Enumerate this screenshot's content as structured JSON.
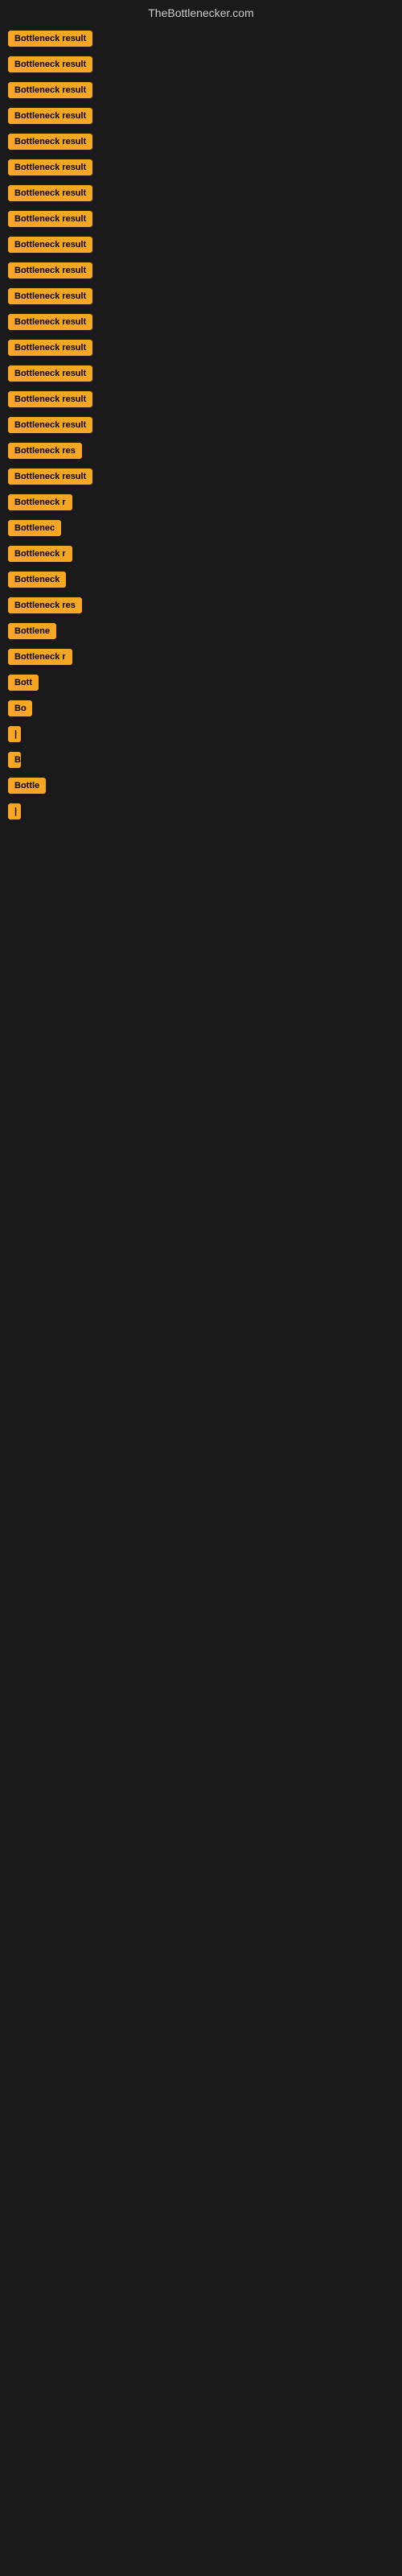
{
  "site": {
    "title": "TheBottlenecker.com"
  },
  "items": [
    {
      "label": "Bottleneck result",
      "width": 130
    },
    {
      "label": "Bottleneck result",
      "width": 130
    },
    {
      "label": "Bottleneck result",
      "width": 130
    },
    {
      "label": "Bottleneck result",
      "width": 130
    },
    {
      "label": "Bottleneck result",
      "width": 130
    },
    {
      "label": "Bottleneck result",
      "width": 130
    },
    {
      "label": "Bottleneck result",
      "width": 130
    },
    {
      "label": "Bottleneck result",
      "width": 130
    },
    {
      "label": "Bottleneck result",
      "width": 130
    },
    {
      "label": "Bottleneck result",
      "width": 130
    },
    {
      "label": "Bottleneck result",
      "width": 130
    },
    {
      "label": "Bottleneck result",
      "width": 130
    },
    {
      "label": "Bottleneck result",
      "width": 130
    },
    {
      "label": "Bottleneck result",
      "width": 130
    },
    {
      "label": "Bottleneck result",
      "width": 130
    },
    {
      "label": "Bottleneck result",
      "width": 130
    },
    {
      "label": "Bottleneck res",
      "width": 108
    },
    {
      "label": "Bottleneck result",
      "width": 118
    },
    {
      "label": "Bottleneck r",
      "width": 94
    },
    {
      "label": "Bottlenec",
      "width": 80
    },
    {
      "label": "Bottleneck r",
      "width": 90
    },
    {
      "label": "Bottleneck",
      "width": 82
    },
    {
      "label": "Bottleneck res",
      "width": 102
    },
    {
      "label": "Bottlene",
      "width": 74
    },
    {
      "label": "Bottleneck r",
      "width": 88
    },
    {
      "label": "Bott",
      "width": 46
    },
    {
      "label": "Bo",
      "width": 30
    },
    {
      "label": "|",
      "width": 10
    },
    {
      "label": "B",
      "width": 16
    },
    {
      "label": "Bottle",
      "width": 50
    },
    {
      "label": "|",
      "width": 8
    }
  ]
}
